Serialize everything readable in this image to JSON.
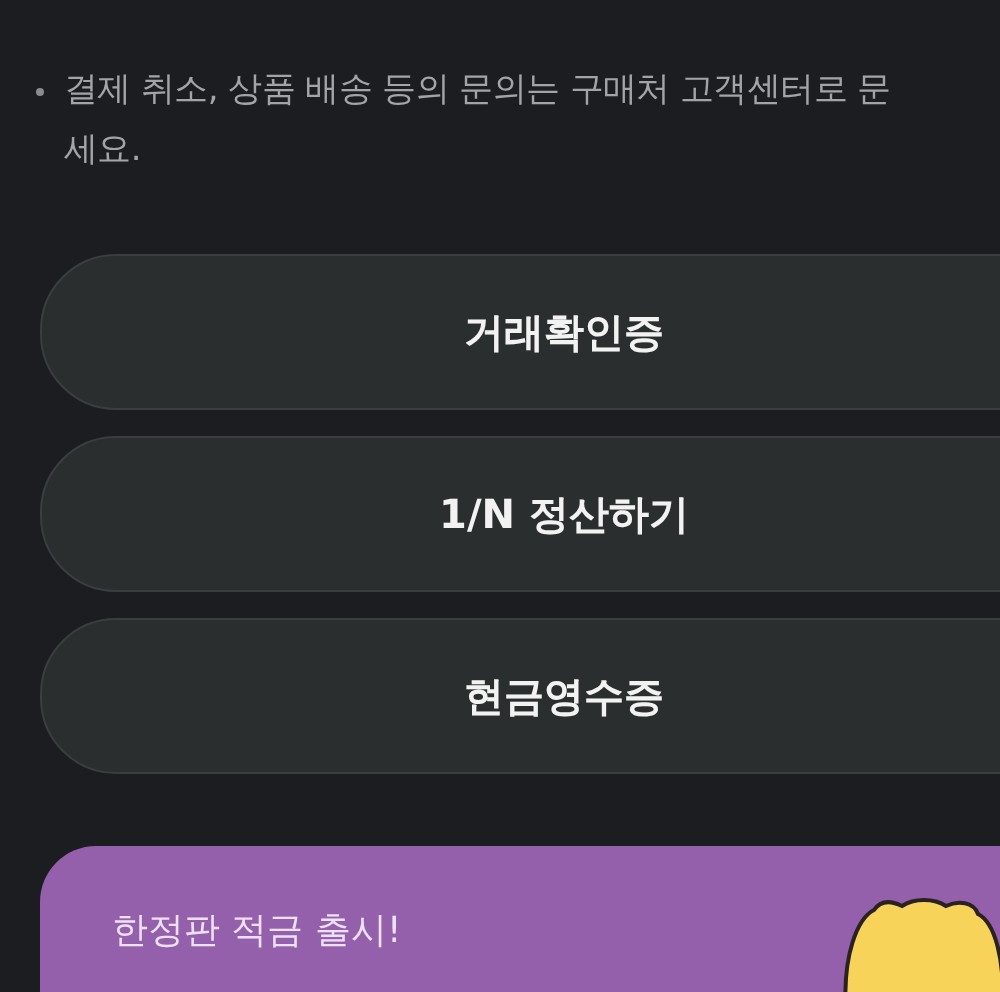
{
  "notice": {
    "lines": [
      "결제 취소, 상품 배송 등의 문의는 구매처 고객센터로 문",
      "세요."
    ]
  },
  "buttons": [
    {
      "label": "거래확인증"
    },
    {
      "label": "1/N 정산하기"
    },
    {
      "label": "현금영수증"
    }
  ],
  "promo": {
    "title": "한정판 적금 출시!"
  }
}
